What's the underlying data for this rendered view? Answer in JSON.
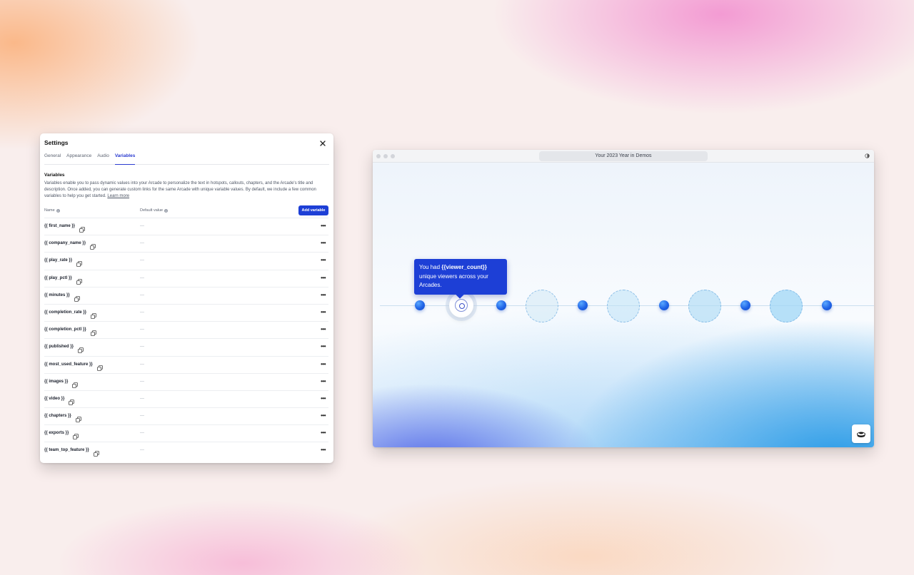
{
  "settings": {
    "title": "Settings",
    "tabs": [
      "General",
      "Appearance",
      "Audio",
      "Variables"
    ],
    "active_tab": "Variables",
    "section_title": "Variables",
    "description": "Variables enable you to pass dynamic values into your Arcade to personalize the text in hotspots, callouts, chapters, and the Arcade's title and description. Once added, you can generate custom links for the same Arcade with unique variable values. By default, we include a few common variables to help you get started.",
    "learn_more": "Learn more",
    "columns": {
      "name": "Name",
      "default_value": "Default value"
    },
    "add_button": "Add variable",
    "rows": [
      {
        "name": "{{ first_name }}",
        "default": "—"
      },
      {
        "name": "{{ company_name }}",
        "default": "—"
      },
      {
        "name": "{{ play_rate }}",
        "default": "—"
      },
      {
        "name": "{{ play_pctl }}",
        "default": "—"
      },
      {
        "name": "{{ minutes }}",
        "default": "—"
      },
      {
        "name": "{{ completion_rate }}",
        "default": "—"
      },
      {
        "name": "{{ completion_pctl }}",
        "default": "—"
      },
      {
        "name": "{{ published }}",
        "default": "—"
      },
      {
        "name": "{{ most_used_feature }}",
        "default": "—"
      },
      {
        "name": "{{ images }}",
        "default": "—"
      },
      {
        "name": "{{ video }}",
        "default": "—"
      },
      {
        "name": "{{ chapters }}",
        "default": "—"
      },
      {
        "name": "{{ exports }}",
        "default": "—"
      },
      {
        "name": "{{ team_top_feature }}",
        "default": "—"
      }
    ],
    "more_label": "•••"
  },
  "browser": {
    "url_title": "Your 2023 Year in Demos",
    "tooltip": {
      "prefix": "You had ",
      "variable": "{{viewer_count}}",
      "suffix": "unique viewers across your Arcades."
    }
  },
  "colors": {
    "accent": "#1d3fd6",
    "node": "#1f63e6"
  }
}
